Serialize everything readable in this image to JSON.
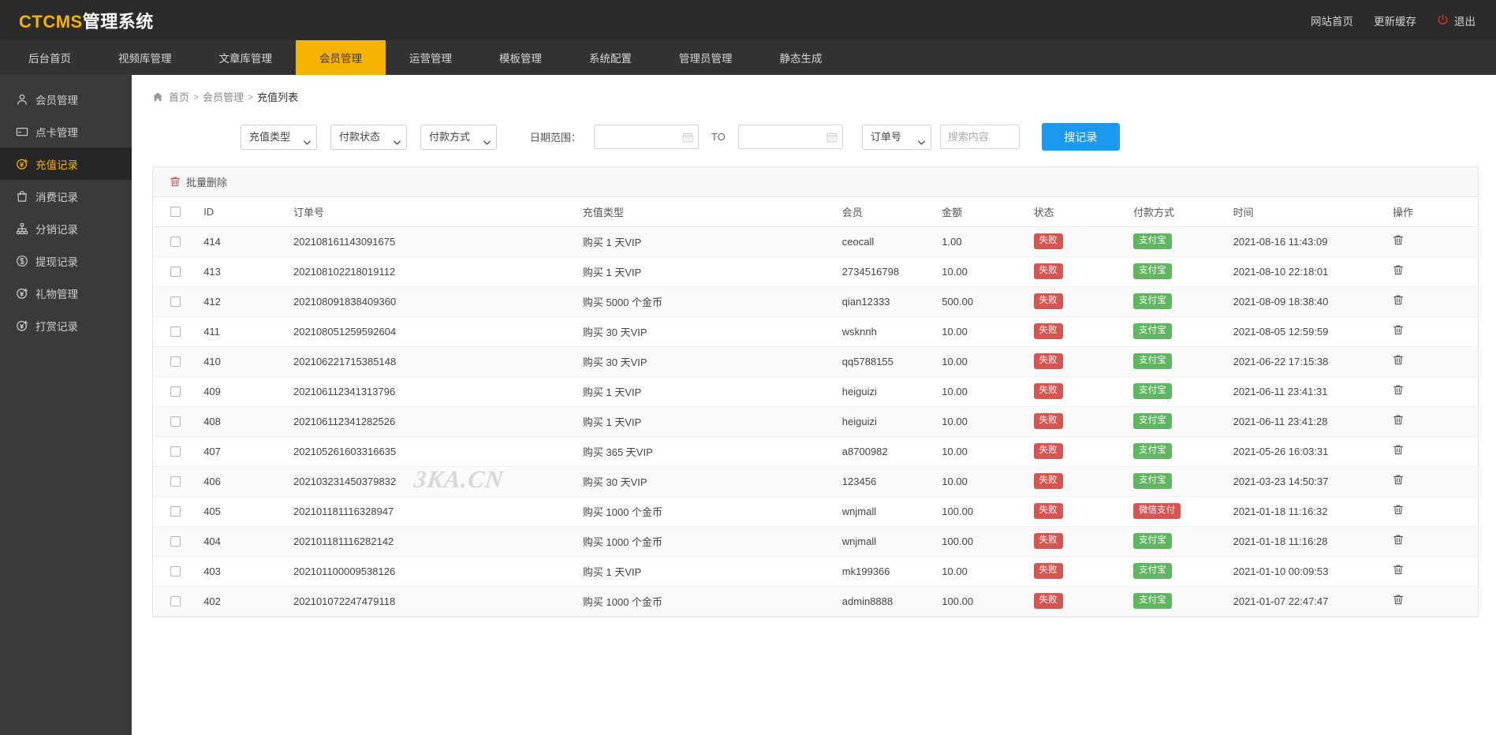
{
  "header": {
    "logo_en": "CTCMS",
    "logo_cn": "管理系统",
    "links": [
      {
        "label": "网站首页",
        "name": "site-home-link"
      },
      {
        "label": "更新缓存",
        "name": "refresh-cache-link"
      }
    ],
    "logout_label": "退出",
    "power_icon": "power-icon",
    "accent_color": "#f5b301",
    "bg_color": "#2b2b2b"
  },
  "nav": {
    "items": [
      {
        "label": "后台首页",
        "active": false
      },
      {
        "label": "视频库管理",
        "active": false
      },
      {
        "label": "文章库管理",
        "active": false
      },
      {
        "label": "会员管理",
        "active": true
      },
      {
        "label": "运营管理",
        "active": false
      },
      {
        "label": "模板管理",
        "active": false
      },
      {
        "label": "系统配置",
        "active": false
      },
      {
        "label": "管理员管理",
        "active": false
      },
      {
        "label": "静态生成",
        "active": false
      }
    ]
  },
  "sidebar": {
    "items": [
      {
        "label": "会员管理",
        "icon": "user-icon",
        "active": false
      },
      {
        "label": "点卡管理",
        "icon": "card-icon",
        "active": false
      },
      {
        "label": "充值记录",
        "icon": "coin-yen-icon",
        "active": true
      },
      {
        "label": "消费记录",
        "icon": "bag-icon",
        "active": false
      },
      {
        "label": "分销记录",
        "icon": "sitemap-icon",
        "active": false
      },
      {
        "label": "提现记录",
        "icon": "dollar-circle-icon",
        "active": false
      },
      {
        "label": "礼物管理",
        "icon": "gift-yen-icon",
        "active": false
      },
      {
        "label": "打赏记录",
        "icon": "reward-yen-icon",
        "active": false
      }
    ]
  },
  "breadcrumb": {
    "home_icon": "home-icon",
    "items": [
      {
        "label": "首页",
        "link": true
      },
      {
        "label": "会员管理",
        "link": true
      },
      {
        "label": "充值列表",
        "link": false
      }
    ],
    "separator": ">"
  },
  "filters": {
    "recharge_type": {
      "value": "充值类型",
      "options": [
        "充值类型"
      ]
    },
    "pay_status": {
      "value": "付款状态",
      "options": [
        "付款状态"
      ]
    },
    "pay_method": {
      "value": "付款方式",
      "options": [
        "付款方式"
      ]
    },
    "date_label": "日期范围：",
    "date_from": {
      "value": "",
      "placeholder": ""
    },
    "to_label": "TO",
    "date_to": {
      "value": "",
      "placeholder": ""
    },
    "search_field": {
      "value": "订单号",
      "options": [
        "订单号"
      ]
    },
    "search_text": {
      "value": "",
      "placeholder": "搜索内容"
    },
    "search_button": "搜记录",
    "search_button_color": "#1b9bf0",
    "calendar_icon": "calendar-icon",
    "caret_icon": "chevron-down-icon"
  },
  "toolbar": {
    "bulk_delete_label": "批量删除",
    "trash_icon": "trash-icon"
  },
  "table": {
    "columns": [
      {
        "key": "check",
        "label": ""
      },
      {
        "key": "id",
        "label": "ID"
      },
      {
        "key": "order",
        "label": "订单号"
      },
      {
        "key": "type",
        "label": "充值类型"
      },
      {
        "key": "user",
        "label": "会员"
      },
      {
        "key": "amount",
        "label": "金额"
      },
      {
        "key": "status",
        "label": "状态"
      },
      {
        "key": "pay",
        "label": "付款方式"
      },
      {
        "key": "time",
        "label": "时间"
      },
      {
        "key": "op",
        "label": "操作"
      }
    ],
    "rows": [
      {
        "id": "414",
        "order": "202108161143091675",
        "type": "购买 1 天VIP",
        "user": "ceocall",
        "amount": "1.00",
        "status": "失败",
        "status_kind": "fail",
        "pay": "支付宝",
        "pay_kind": "alipay",
        "time": "2021-08-16 11:43:09"
      },
      {
        "id": "413",
        "order": "202108102218019112",
        "type": "购买 1 天VIP",
        "user": "2734516798",
        "amount": "10.00",
        "status": "失败",
        "status_kind": "fail",
        "pay": "支付宝",
        "pay_kind": "alipay",
        "time": "2021-08-10 22:18:01"
      },
      {
        "id": "412",
        "order": "202108091838409360",
        "type": "购买 5000 个金币",
        "user": "qian12333",
        "amount": "500.00",
        "status": "失败",
        "status_kind": "fail",
        "pay": "支付宝",
        "pay_kind": "alipay",
        "time": "2021-08-09 18:38:40"
      },
      {
        "id": "411",
        "order": "202108051259592604",
        "type": "购买 30 天VIP",
        "user": "wsknnh",
        "amount": "10.00",
        "status": "失败",
        "status_kind": "fail",
        "pay": "支付宝",
        "pay_kind": "alipay",
        "time": "2021-08-05 12:59:59"
      },
      {
        "id": "410",
        "order": "202106221715385148",
        "type": "购买 30 天VIP",
        "user": "qq5788155",
        "amount": "10.00",
        "status": "失败",
        "status_kind": "fail",
        "pay": "支付宝",
        "pay_kind": "alipay",
        "time": "2021-06-22 17:15:38"
      },
      {
        "id": "409",
        "order": "202106112341313796",
        "type": "购买 1 天VIP",
        "user": "heiguizi",
        "amount": "10.00",
        "status": "失败",
        "status_kind": "fail",
        "pay": "支付宝",
        "pay_kind": "alipay",
        "time": "2021-06-11 23:41:31"
      },
      {
        "id": "408",
        "order": "202106112341282526",
        "type": "购买 1 天VIP",
        "user": "heiguizi",
        "amount": "10.00",
        "status": "失败",
        "status_kind": "fail",
        "pay": "支付宝",
        "pay_kind": "alipay",
        "time": "2021-06-11 23:41:28"
      },
      {
        "id": "407",
        "order": "202105261603316635",
        "type": "购买 365 天VIP",
        "user": "a8700982",
        "amount": "10.00",
        "status": "失败",
        "status_kind": "fail",
        "pay": "支付宝",
        "pay_kind": "alipay",
        "time": "2021-05-26 16:03:31"
      },
      {
        "id": "406",
        "order": "202103231450379832",
        "type": "购买 30 天VIP",
        "user": "123456",
        "amount": "10.00",
        "status": "失败",
        "status_kind": "fail",
        "pay": "支付宝",
        "pay_kind": "alipay",
        "time": "2021-03-23 14:50:37"
      },
      {
        "id": "405",
        "order": "202101181116328947",
        "type": "购买 1000 个金币",
        "user": "wnjmall",
        "amount": "100.00",
        "status": "失败",
        "status_kind": "fail",
        "pay": "微信支付",
        "pay_kind": "wechat",
        "time": "2021-01-18 11:16:32"
      },
      {
        "id": "404",
        "order": "202101181116282142",
        "type": "购买 1000 个金币",
        "user": "wnjmall",
        "amount": "100.00",
        "status": "失败",
        "status_kind": "fail",
        "pay": "支付宝",
        "pay_kind": "alipay",
        "time": "2021-01-18 11:16:28"
      },
      {
        "id": "403",
        "order": "202101100009538126",
        "type": "购买 1 天VIP",
        "user": "mk199366",
        "amount": "10.00",
        "status": "失败",
        "status_kind": "fail",
        "pay": "支付宝",
        "pay_kind": "alipay",
        "time": "2021-01-10 00:09:53"
      },
      {
        "id": "402",
        "order": "202101072247479118",
        "type": "购买 1000 个金币",
        "user": "admin8888",
        "amount": "100.00",
        "status": "失败",
        "status_kind": "fail",
        "pay": "支付宝",
        "pay_kind": "alipay",
        "time": "2021-01-07 22:47:47"
      }
    ],
    "row_delete_icon": "trash-icon"
  },
  "watermark": {
    "text": "3KA.CN"
  },
  "colors": {
    "accent": "#f5b301",
    "fail": "#d9534f",
    "alipay": "#5cb85c",
    "wechat": "#d9534f",
    "primary": "#1b9bf0"
  }
}
